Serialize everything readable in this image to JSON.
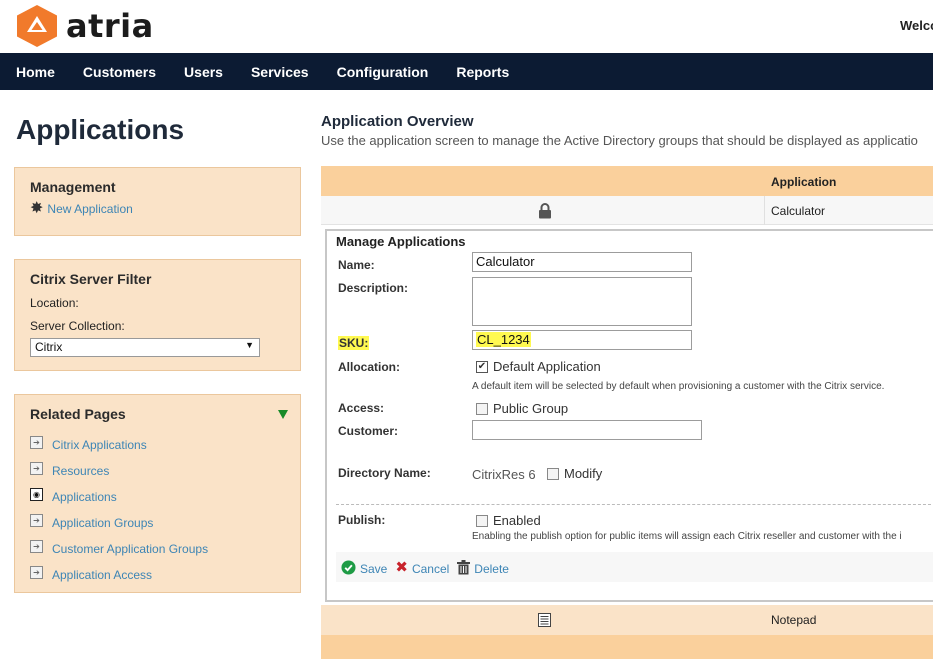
{
  "header": {
    "logo_text": "atria",
    "welcome": "Welco",
    "brand_color": "#f17a2b"
  },
  "nav": {
    "items": [
      "Home",
      "Customers",
      "Users",
      "Services",
      "Configuration",
      "Reports"
    ]
  },
  "page_title": "Applications",
  "management": {
    "title": "Management",
    "new_application": "New Application",
    "icon": "star-burst-icon"
  },
  "filter": {
    "title": "Citrix Server Filter",
    "location_label": "Location:",
    "collection_label": "Server Collection:",
    "collection_value": "Citrix"
  },
  "related": {
    "title": "Related Pages",
    "items": [
      {
        "label": "Citrix Applications",
        "icon": "arrow-page-icon"
      },
      {
        "label": "Resources",
        "icon": "arrow-page-icon"
      },
      {
        "label": "Applications",
        "icon": "current-page-icon"
      },
      {
        "label": "Application Groups",
        "icon": "arrow-page-icon"
      },
      {
        "label": "Customer Application Groups",
        "icon": "arrow-page-icon"
      },
      {
        "label": "Application Access",
        "icon": "arrow-page-icon"
      }
    ]
  },
  "overview": {
    "title": "Application Overview",
    "description": "Use the application screen to manage the Active Directory groups that should be displayed as applicatio"
  },
  "table": {
    "header_application": "Application",
    "rows": [
      {
        "application": "Calculator",
        "icon": "lock-icon"
      }
    ],
    "bottom_row": {
      "application": "Notepad",
      "icon": "notepad-icon"
    }
  },
  "form": {
    "title": "Manage Applications",
    "name_label": "Name:",
    "name_value": "Calculator",
    "description_label": "Description:",
    "description_value": "",
    "sku_label": "SKU:",
    "sku_value": "CL_1234",
    "allocation_label": "Allocation:",
    "default_application_label": "Default Application",
    "default_application_checked": true,
    "allocation_hint": "A default item will be selected by default when provisioning a customer with the Citrix service.",
    "access_label": "Access:",
    "public_group_label": "Public Group",
    "public_group_checked": false,
    "customer_label": "Customer:",
    "customer_value": "",
    "directory_label": "Directory Name:",
    "directory_value": "CitrixRes 6",
    "modify_label": "Modify",
    "modify_checked": false,
    "publish_label": "Publish:",
    "enabled_label": "Enabled",
    "enabled_checked": false,
    "publish_hint": "Enabling the publish option for public items will assign each Citrix reseller and customer with the i",
    "save_label": "Save",
    "cancel_label": "Cancel",
    "delete_label": "Delete",
    "highlight_color": "#fff950"
  }
}
